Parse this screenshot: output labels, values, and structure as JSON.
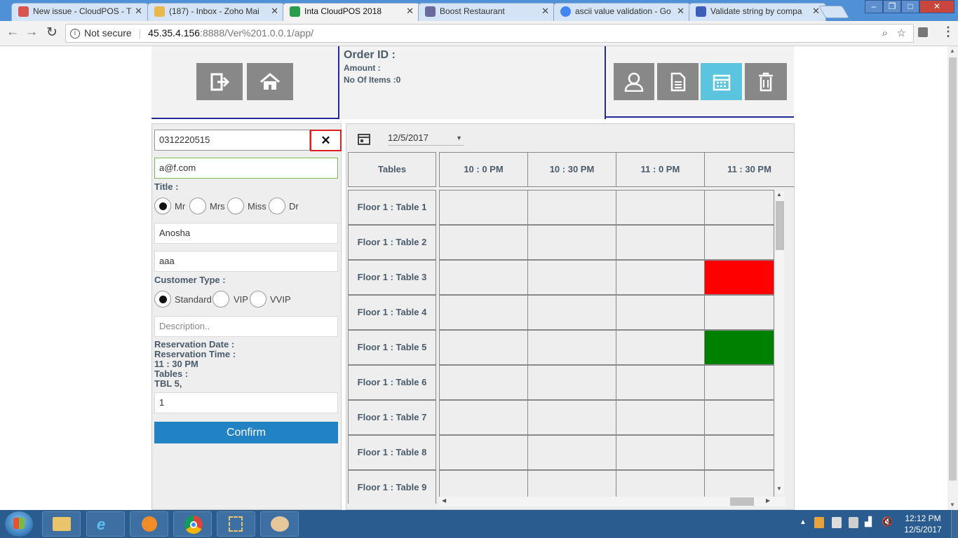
{
  "browser": {
    "tabs": [
      {
        "title": "New issue - CloudPOS - T",
        "fav_color": "#d9534f"
      },
      {
        "title": "(187) - Inbox - Zoho Mai",
        "fav_color": "#e8b84a"
      },
      {
        "title": "Inta CloudPOS 2018",
        "fav_color": "#2a9d4b"
      },
      {
        "title": "Boost Restaurant",
        "fav_color": "#6b6b9b"
      },
      {
        "title": "ascii value validation - Go",
        "fav_color": "#4285f4"
      },
      {
        "title": "Validate string by compa",
        "fav_color": "#3b5fb8"
      }
    ],
    "security": "Not secure",
    "url_host": "45.35.4.156",
    "url_rest": ":8888/Ver%201.0.0.1/app/"
  },
  "order": {
    "title": "Order ID :",
    "amount_label": "Amount :",
    "items_label": "No Of Items :0"
  },
  "form": {
    "phone": "0312220515",
    "email": "a@f.com",
    "title_label": "Title :",
    "titles": [
      "Mr",
      "Mrs",
      "Miss",
      "Dr"
    ],
    "first_name": "Anosha",
    "last_name": "aaa",
    "customer_type_label": "Customer Type :",
    "customer_types": [
      "Standard",
      "VIP",
      "VVIP"
    ],
    "description_placeholder": "Description..",
    "reservation_date_label": "Reservation Date :",
    "reservation_time_label": "Reservation Time :",
    "reservation_time": "11 : 30 PM",
    "tables_label": "Tables :",
    "tables_value": "TBL 5,",
    "guests": "1",
    "confirm": "Confirm"
  },
  "grid": {
    "date": "12/5/2017",
    "tables_header": "Tables",
    "times": [
      "10 : 0 PM",
      "10 : 30 PM",
      "11 : 0 PM",
      "11 : 30 PM"
    ],
    "rows": [
      "Floor 1 : Table 1",
      "Floor 1 : Table 2",
      "Floor 1 : Table 3",
      "Floor 1 : Table 4",
      "Floor 1 : Table 5",
      "Floor 1 : Table 6",
      "Floor 1 : Table 7",
      "Floor 1 : Table 8",
      "Floor 1 : Table 9"
    ],
    "status_colors": {
      "booked": "#ff0000",
      "selected": "#008000"
    },
    "highlights": [
      {
        "row": 2,
        "col": 3,
        "status": "booked"
      },
      {
        "row": 4,
        "col": 3,
        "status": "selected"
      }
    ]
  },
  "taskbar": {
    "time": "12:12 PM",
    "date": "12/5/2017"
  }
}
